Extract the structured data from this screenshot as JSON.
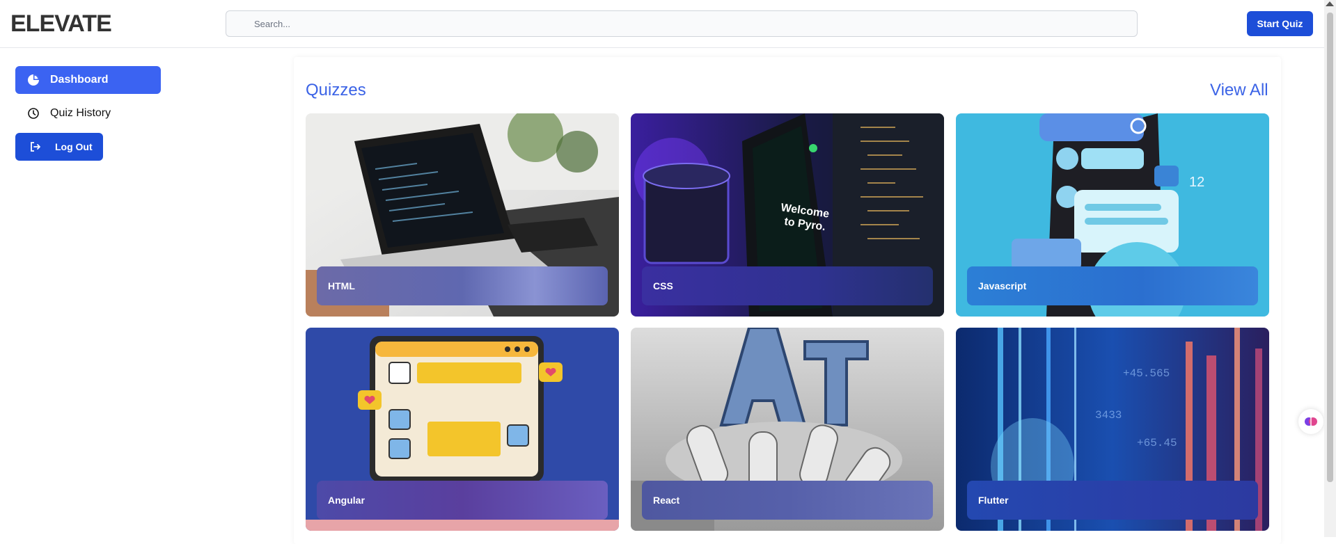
{
  "header": {
    "logo_text": "ELEVATE",
    "search_placeholder": "Search...",
    "start_quiz_label": "Start Quiz"
  },
  "sidebar": {
    "items": [
      {
        "label": "Dashboard",
        "icon": "pie-chart-icon",
        "active": true
      },
      {
        "label": "Quiz History",
        "icon": "clock-icon",
        "active": false
      },
      {
        "label": "Log Out",
        "icon": "logout-icon",
        "active": false
      }
    ]
  },
  "main": {
    "title": "Quizzes",
    "view_all_label": "View All",
    "cards": [
      {
        "label": "HTML"
      },
      {
        "label": "CSS"
      },
      {
        "label": "Javascript"
      },
      {
        "label": "Angular"
      },
      {
        "label": "React"
      },
      {
        "label": "Flutter"
      }
    ]
  },
  "colors": {
    "primary": "#1d4ed8",
    "active_nav": "#3b63f2",
    "heading": "#3b63e6"
  }
}
